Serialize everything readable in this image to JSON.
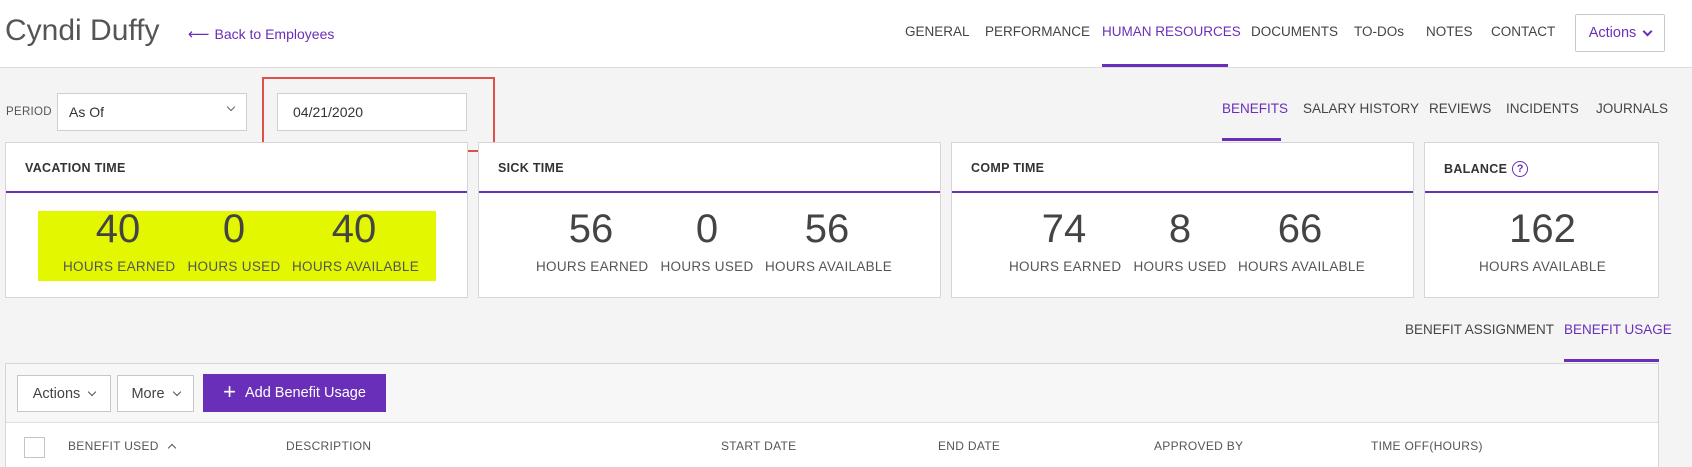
{
  "header": {
    "employee_name": "Cyndi Duffy",
    "back_label": "Back to Employees",
    "nav": [
      "GENERAL",
      "PERFORMANCE",
      "HUMAN RESOURCES",
      "DOCUMENTS",
      "TO-DOs",
      "NOTES",
      "CONTACT"
    ],
    "active_nav": "HUMAN RESOURCES",
    "actions_label": "Actions"
  },
  "period": {
    "label": "PERIOD",
    "select_value": "As Of",
    "date_value": "04/21/2020"
  },
  "sub_nav": [
    "BENEFITS",
    "SALARY HISTORY",
    "REVIEWS",
    "INCIDENTS",
    "JOURNALS"
  ],
  "cards": {
    "vacation": {
      "title": "VACATION TIME",
      "earned": "40",
      "earned_label": "HOURS EARNED",
      "used": "0",
      "used_label": "HOURS USED",
      "available": "40",
      "available_label": "HOURS AVAILABLE"
    },
    "sick": {
      "title": "SICK TIME",
      "earned": "56",
      "earned_label": "HOURS EARNED",
      "used": "0",
      "used_label": "HOURS USED",
      "available": "56",
      "available_label": "HOURS AVAILABLE"
    },
    "comp": {
      "title": "COMP TIME",
      "earned": "74",
      "earned_label": "HOURS EARNED",
      "used": "8",
      "used_label": "HOURS USED",
      "available": "66",
      "available_label": "HOURS AVAILABLE"
    },
    "balance": {
      "title": "BALANCE",
      "help": "?",
      "available": "162",
      "available_label": "HOURS AVAILABLE"
    }
  },
  "benefit_tabs": [
    "BENEFIT ASSIGNMENT",
    "BENEFIT USAGE"
  ],
  "toolbar": {
    "actions_label": "Actions",
    "more_label": "More",
    "add_label": "Add Benefit Usage"
  },
  "table": {
    "columns": [
      "BENEFIT USED",
      "DESCRIPTION",
      "START DATE",
      "END DATE",
      "APPROVED BY",
      "TIME OFF(HOURS)"
    ]
  },
  "colors": {
    "accent": "#6a2fb8",
    "highlight_box": "#e0504a",
    "highlight_fill": "#e2f700"
  }
}
